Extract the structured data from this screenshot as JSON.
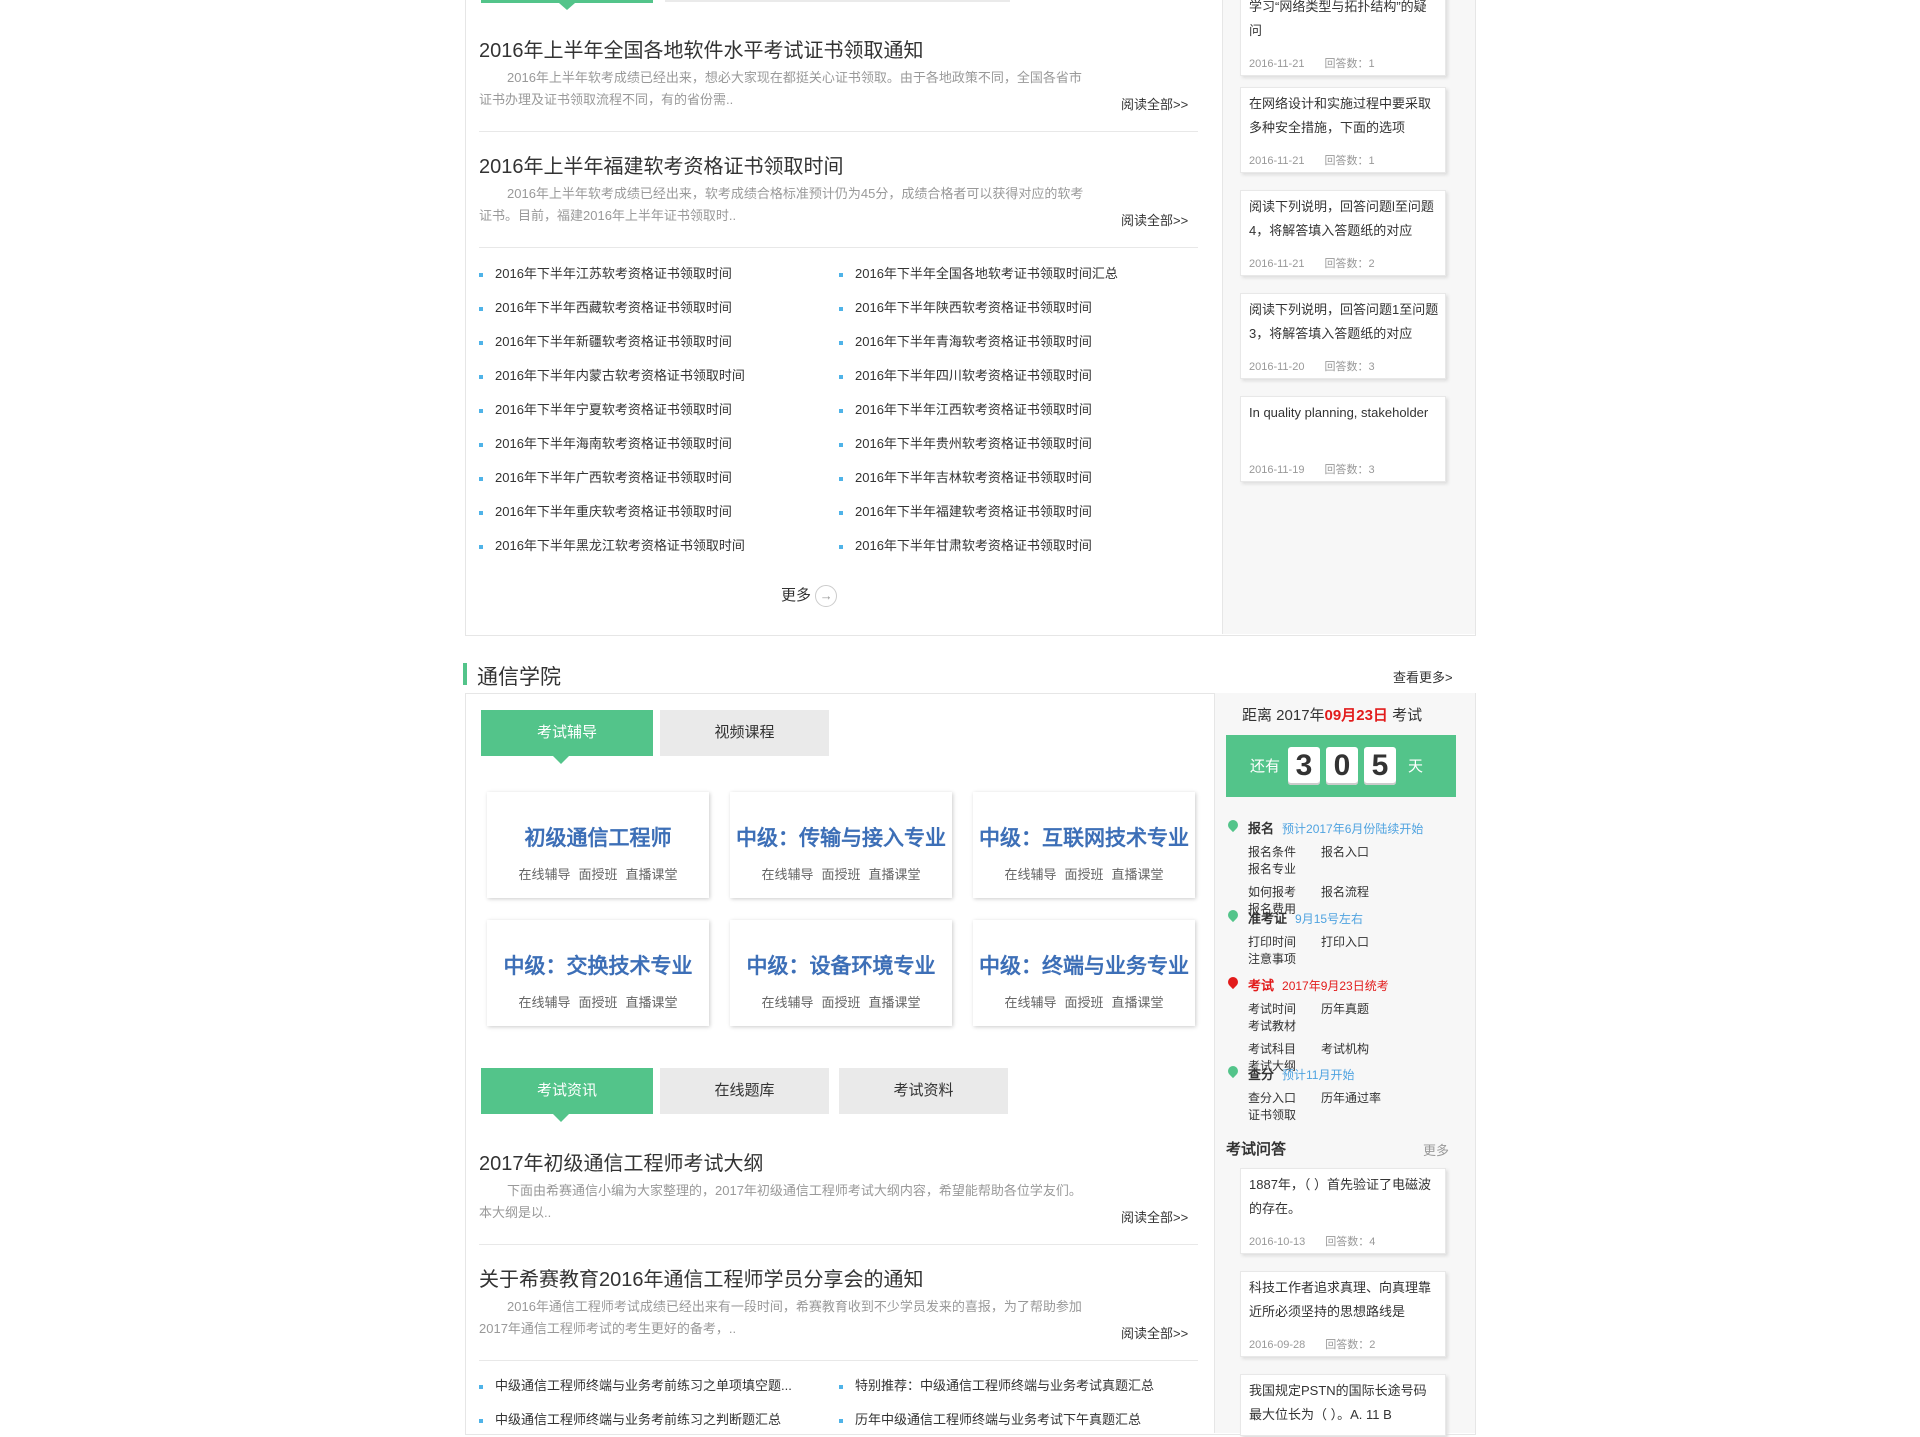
{
  "upper": {
    "articles": [
      {
        "title": "2016年上半年全国各地软件水平考试证书领取通知",
        "desc": "2016年上半年软考成绩已经出来，想必大家现在都挺关心证书领取。由于各地政策不同，全国各省市证书办理及证书领取流程不同，有的省份需..",
        "read": "阅读全部>>"
      },
      {
        "title": "2016年上半年福建软考资格证书领取时间",
        "desc": "2016年上半年软考成绩已经出来，软考成绩合格标准预计仍为45分，成绩合格者可以获得对应的软考证书。目前，福建2016年上半年证书领取时..",
        "read": "阅读全部>>"
      }
    ],
    "list_left": [
      "2016年下半年江苏软考资格证书领取时间",
      "2016年下半年西藏软考资格证书领取时间",
      "2016年下半年新疆软考资格证书领取时间",
      "2016年下半年内蒙古软考资格证书领取时间",
      "2016年下半年宁夏软考资格证书领取时间",
      "2016年下半年海南软考资格证书领取时间",
      "2016年下半年广西软考资格证书领取时间",
      "2016年下半年重庆软考资格证书领取时间",
      "2016年下半年黑龙江软考资格证书领取时间"
    ],
    "list_right": [
      "2016年下半年全国各地软考证书领取时间汇总",
      "2016年下半年陕西软考资格证书领取时间",
      "2016年下半年青海软考资格证书领取时间",
      "2016年下半年四川软考资格证书领取时间",
      "2016年下半年江西软考资格证书领取时间",
      "2016年下半年贵州软考资格证书领取时间",
      "2016年下半年吉林软考资格证书领取时间",
      "2016年下半年福建软考资格证书领取时间",
      "2016年下半年甘肃软考资格证书领取时间"
    ],
    "more": "更多",
    "qa": [
      {
        "q": "学习“网络类型与拓扑结构”的疑问",
        "date": "2016-11-21",
        "answers": "回答数：1"
      },
      {
        "q": "在网络设计和实施过程中要采取多种安全措施，下面的选项",
        "date": "2016-11-21",
        "answers": "回答数：1"
      },
      {
        "q": "阅读下列说明，回答问题l至问题4，将解答填入答题纸的对应",
        "date": "2016-11-21",
        "answers": "回答数：2"
      },
      {
        "q": "阅读下列说明，回答问题1至问题3，将解答填入答题纸的对应",
        "date": "2016-11-20",
        "answers": "回答数：3"
      },
      {
        "q": "In quality planning, stakeholder",
        "date": "2016-11-19",
        "answers": "回答数：3"
      }
    ]
  },
  "section": {
    "title": "通信学院",
    "more": "查看更多>",
    "tabs1": [
      "考试辅导",
      "视频课程"
    ],
    "courses": [
      {
        "title": "初级通信工程师",
        "links": [
          "在线辅导",
          "面授班",
          "直播课堂"
        ]
      },
      {
        "title": "中级：传输与接入专业",
        "links": [
          "在线辅导",
          "面授班",
          "直播课堂"
        ]
      },
      {
        "title": "中级：互联网技术专业",
        "links": [
          "在线辅导",
          "面授班",
          "直播课堂"
        ]
      },
      {
        "title": "中级：交换技术专业",
        "links": [
          "在线辅导",
          "面授班",
          "直播课堂"
        ]
      },
      {
        "title": "中级：设备环境专业",
        "links": [
          "在线辅导",
          "面授班",
          "直播课堂"
        ]
      },
      {
        "title": "中级：终端与业务专业",
        "links": [
          "在线辅导",
          "面授班",
          "直播课堂"
        ]
      }
    ],
    "tabs2": [
      "考试资讯",
      "在线题库",
      "考试资料"
    ],
    "articles": [
      {
        "title": "2017年初级通信工程师考试大纲",
        "desc": "下面由希赛通信小编为大家整理的，2017年初级通信工程师考试大纲内容，希望能帮助各位学友们。 本大纲是以..",
        "read": "阅读全部>>"
      },
      {
        "title": "关于希赛教育2016年通信工程师学员分享会的通知",
        "desc": "2016年通信工程师考试成绩已经出来有一段时间，希赛教育收到不少学员发来的喜报，为了帮助参加2017年通信工程师考试的考生更好的备考，..",
        "read": "阅读全部>>"
      }
    ],
    "list_left": [
      "中级通信工程师终端与业务考前练习之单项填空题...",
      "中级通信工程师终端与业务考前练习之判断题汇总"
    ],
    "list_right": [
      "特别推荐：中级通信工程师终端与业务考试真题汇总",
      "历年中级通信工程师终端与业务考试下午真题汇总"
    ]
  },
  "countdown": {
    "prefix": "距离 2017年",
    "date": "09月23日",
    "suffix": " 考试",
    "left": "还有",
    "digits": [
      "3",
      "0",
      "5"
    ],
    "unit": "天"
  },
  "schedule": [
    {
      "label": "报名",
      "note": "预计2017年6月份陆续开始",
      "red": false,
      "subs": [
        [
          "报名条件",
          "报名入口",
          "报名专业"
        ],
        [
          "如何报考",
          "报名流程",
          "报名费用"
        ]
      ]
    },
    {
      "label": "准考证",
      "note": "9月15号左右",
      "red": false,
      "subs": [
        [
          "打印时间",
          "打印入口",
          "注意事项"
        ]
      ]
    },
    {
      "label": "考试",
      "note": "2017年9月23日统考",
      "red": true,
      "subs": [
        [
          "考试时间",
          "历年真题",
          "考试教材"
        ],
        [
          "考试科目",
          "考试机构",
          "考试大纲"
        ]
      ]
    },
    {
      "label": "查分",
      "note": "预计11月开始",
      "red": false,
      "subs": [
        [
          "查分入口",
          "历年通过率",
          "证书领取"
        ]
      ]
    }
  ],
  "qa2": {
    "title": "考试问答",
    "more": "更多",
    "items": [
      {
        "q": "1887年，（ ）首先验证了电磁波的存在。",
        "date": "2016-10-13",
        "answers": "回答数：4"
      },
      {
        "q": "科技工作者追求真理、向真理靠近所必须坚持的思想路线是",
        "date": "2016-09-28",
        "answers": "回答数：2"
      },
      {
        "q": "我国规定PSTN的国际长途号码最大位长为（ ）。A. 11 B",
        "date": "",
        "answers": ""
      }
    ]
  },
  "colors": {
    "accent": "#53c48a",
    "link_blue": "#3d6fb7",
    "red": "#e21b1b"
  }
}
